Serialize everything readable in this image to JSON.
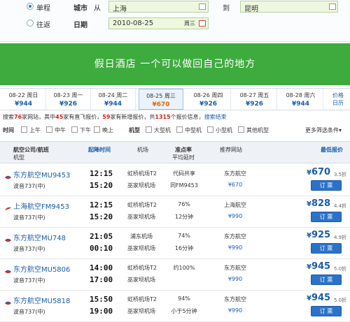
{
  "search": {
    "trip_types": [
      "单程",
      "往返"
    ],
    "city_label": "城市",
    "from_label": "从",
    "to_label": "到",
    "from_value": "上海",
    "to_value": "昆明",
    "date_label": "日期",
    "date_value": "2010-08-25",
    "date_weekday": "周三"
  },
  "banner": {
    "text": "假日酒店 一个可以做回自己的地方"
  },
  "dates": [
    {
      "date": "08-22 周日",
      "price": "¥944"
    },
    {
      "date": "08-23 周一",
      "price": "¥926"
    },
    {
      "date": "08-24 周二",
      "price": "¥944"
    },
    {
      "date": "08-25 周三",
      "price": "¥670"
    },
    {
      "date": "08-26 周四",
      "price": "¥926"
    },
    {
      "date": "08-27 周五",
      "price": "¥926"
    },
    {
      "date": "08-28 周六",
      "price": "¥944"
    }
  ],
  "price_calendar": {
    "line1": "价格",
    "line2": "日历"
  },
  "summary": {
    "p1": "搜索",
    "sites": "76",
    "p2": "家网站，其中",
    "direct": "45",
    "p3": "家有直飞报价，",
    "new": "59",
    "p4": "家有新增报价，共",
    "quotes": "1315",
    "p5": "个报价信息，",
    "status": "搜索结束"
  },
  "filters": {
    "time_label": "时间",
    "times": [
      "上午",
      "中午",
      "下午",
      "晚上"
    ],
    "type_label": "机型",
    "types": [
      "大型机",
      "中型机",
      "小型机",
      "其他机型"
    ],
    "more": "更多筛选条件▾"
  },
  "table_header": {
    "airline": "航空公司/航班",
    "model": "机型",
    "time": "起降时间",
    "airport": "机场",
    "punctuality": "准点率",
    "avg_delay": "平均延时",
    "site": "推荐网站",
    "price": "最低报价"
  },
  "flights": [
    {
      "airline": "东方航空MU9453",
      "plane": "波音737(中)",
      "dep": "12:15",
      "arr": "15:20",
      "ap1": "虹桥机场T2",
      "ap2": "巫家坝机场",
      "p1": "代码共享",
      "p2": "同FM9453",
      "site": "东方航空",
      "site_price": "¥670",
      "price": "670",
      "discount": "3.5折",
      "btn": "订 票"
    },
    {
      "airline": "上海航空FM9453",
      "plane": "波音737(中)",
      "dep": "12:15",
      "arr": "15:20",
      "ap1": "虹桥机场T2",
      "ap2": "巫家坝机场",
      "p1": "76%",
      "p2": "12分钟",
      "site": "上海航空",
      "site_price": "¥990",
      "price": "828",
      "discount": "4.4折",
      "btn": "订 票"
    },
    {
      "airline": "东方航空MU748",
      "plane": "波音737(中)",
      "dep": "21:05",
      "arr": "00:10",
      "ap1": "浦东机场",
      "ap2": "巫家坝机场",
      "p1": "74%",
      "p2": "16分钟",
      "site": "东方航空",
      "site_price": "¥990",
      "price": "925",
      "discount": "4.9折",
      "btn": "订 票"
    },
    {
      "airline": "东方航空MU5806",
      "plane": "波音737(中)",
      "dep": "14:00",
      "arr": "17:00",
      "ap1": "虹桥机场T2",
      "ap2": "巫家坝机场",
      "p1": "约100%",
      "p2": "",
      "site": "东方航空",
      "site_price": "¥990",
      "price": "945",
      "discount": "5.0折",
      "btn": "订 票"
    },
    {
      "airline": "东方航空MU5818",
      "plane": "波音737(中)",
      "dep": "15:50",
      "arr": "19:00",
      "ap1": "虹桥机场T2",
      "ap2": "巫家坝机场",
      "p1": "94%",
      "p2": "小于5分钟",
      "site": "东方航空",
      "site_price": "¥990",
      "price": "945",
      "discount": "5.0折",
      "btn": "订 票"
    }
  ]
}
